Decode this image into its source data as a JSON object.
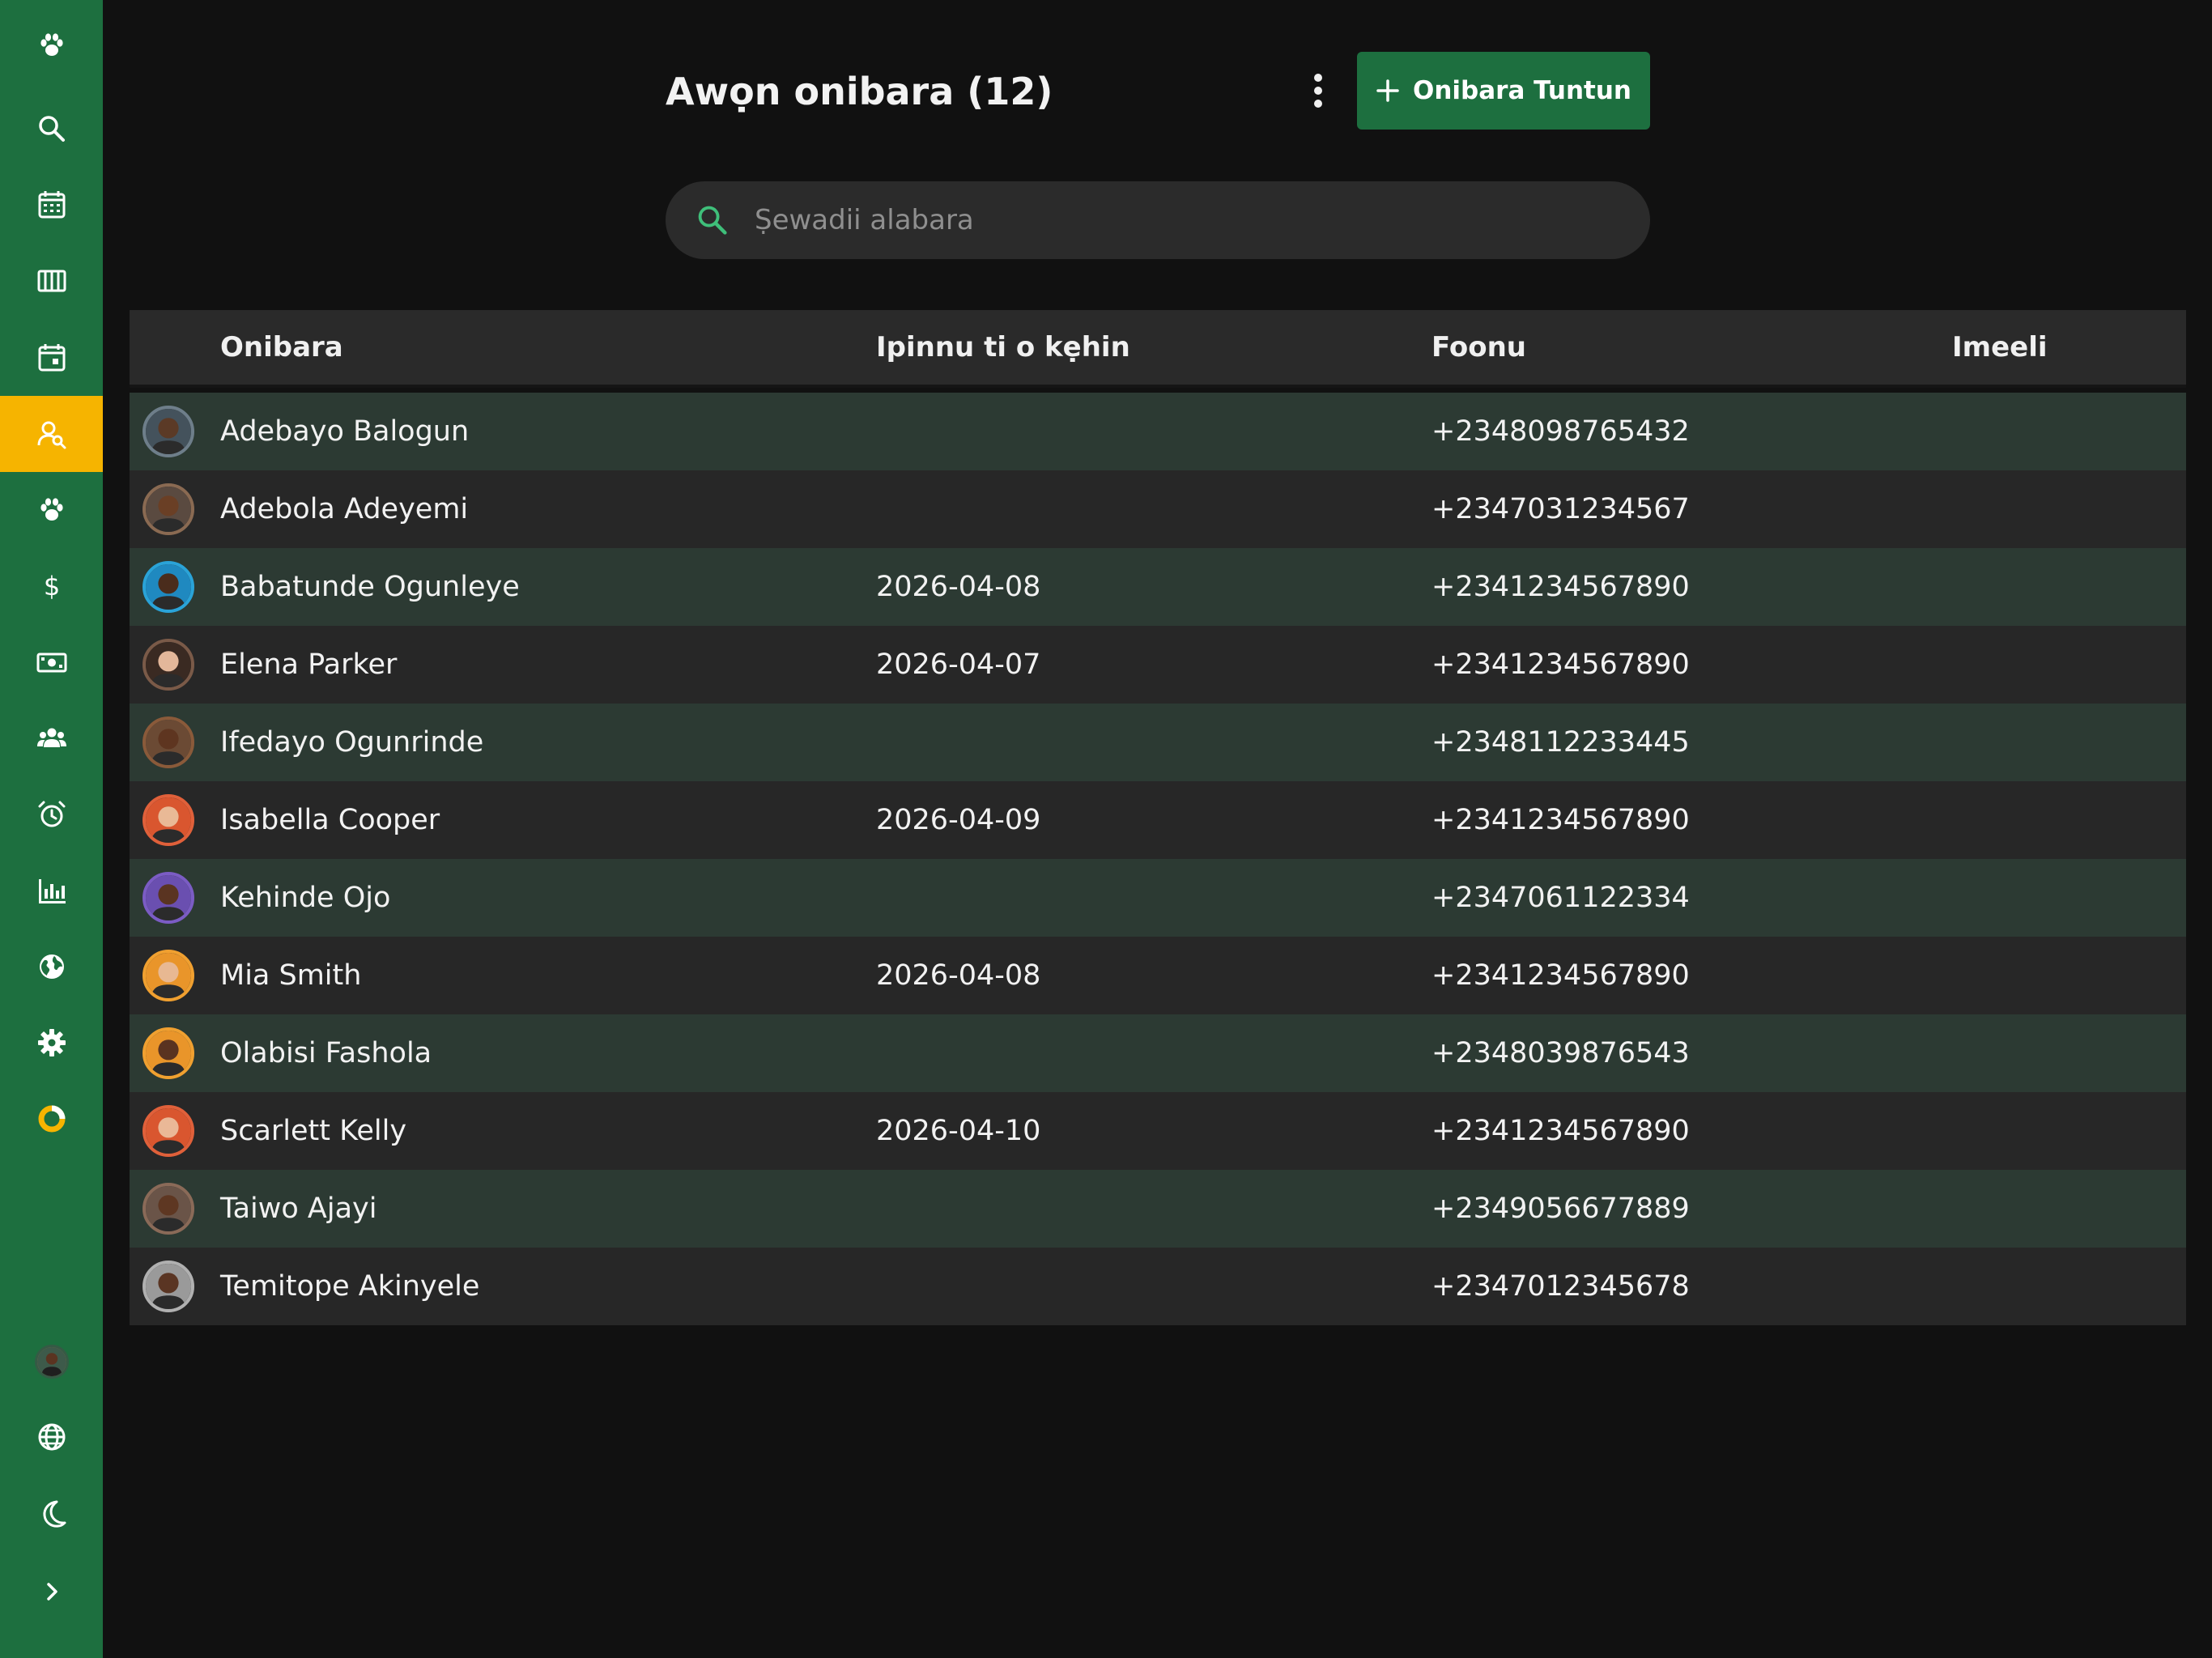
{
  "header": {
    "title": "Awọn onibara (12)",
    "add_button_label": "Onibara Tuntun"
  },
  "search": {
    "placeholder": "Ṣewadii alabara",
    "value": ""
  },
  "table": {
    "columns": [
      "Onibara",
      "Ipinnu ti o kẹhin",
      "Foonu",
      "Imeeli"
    ],
    "rows": [
      {
        "name": "Adebayo Balogun",
        "last_appointment": "",
        "phone": "+2348098765432",
        "email": "",
        "ring": "#6e7e8a",
        "skin": "#5b3a26",
        "bg": "#44525c"
      },
      {
        "name": "Adebola Adeyemi",
        "last_appointment": "",
        "phone": "+2347031234567",
        "email": "",
        "ring": "#8a6a52",
        "skin": "#6a3f25",
        "bg": "#5a4a40"
      },
      {
        "name": "Babatunde Ogunleye",
        "last_appointment": "2026-04-08",
        "phone": "+2341234567890",
        "email": "",
        "ring": "#2aa3d8",
        "skin": "#4a2c1c",
        "bg": "#1f89c0"
      },
      {
        "name": "Elena Parker",
        "last_appointment": "2026-04-07",
        "phone": "+2341234567890",
        "email": "",
        "ring": "#7a5a48",
        "skin": "#e3b79a",
        "bg": "#3a2a22"
      },
      {
        "name": "Ifedayo Ogunrinde",
        "last_appointment": "",
        "phone": "+2348112233445",
        "email": "",
        "ring": "#8a5a3a",
        "skin": "#5e3520",
        "bg": "#6b4a34"
      },
      {
        "name": "Isabella Cooper",
        "last_appointment": "2026-04-09",
        "phone": "+2341234567890",
        "email": "",
        "ring": "#e0603a",
        "skin": "#e9b996",
        "bg": "#d9562f"
      },
      {
        "name": "Kehinde Ojo",
        "last_appointment": "",
        "phone": "+2347061122334",
        "email": "",
        "ring": "#7b5cc4",
        "skin": "#5a3421",
        "bg": "#6a4fb0"
      },
      {
        "name": "Mia Smith",
        "last_appointment": "2026-04-08",
        "phone": "+2341234567890",
        "email": "",
        "ring": "#f0a030",
        "skin": "#e8b892",
        "bg": "#e9952a"
      },
      {
        "name": "Olabisi Fashola",
        "last_appointment": "",
        "phone": "+2348039876543",
        "email": "",
        "ring": "#f0a030",
        "skin": "#5a3320",
        "bg": "#e9952a"
      },
      {
        "name": "Scarlett Kelly",
        "last_appointment": "2026-04-10",
        "phone": "+2341234567890",
        "email": "",
        "ring": "#e0603a",
        "skin": "#eab897",
        "bg": "#d9562f"
      },
      {
        "name": "Taiwo Ajayi",
        "last_appointment": "",
        "phone": "+2349056677889",
        "email": "",
        "ring": "#8a6a58",
        "skin": "#5e3722",
        "bg": "#6a5448"
      },
      {
        "name": "Temitope Akinyele",
        "last_appointment": "",
        "phone": "+2347012345678",
        "email": "",
        "ring": "#b0b0b0",
        "skin": "#5a3523",
        "bg": "#9a9a9a"
      }
    ]
  },
  "sidebar": {
    "items": [
      {
        "icon": "paw-logo-icon"
      },
      {
        "icon": "search-icon"
      },
      {
        "icon": "calendar-icon"
      },
      {
        "icon": "columns-icon"
      },
      {
        "icon": "calendar-day-icon"
      },
      {
        "icon": "customer-search-icon",
        "active": true
      },
      {
        "icon": "paw-icon"
      },
      {
        "icon": "dollar-icon"
      },
      {
        "icon": "cash-icon"
      },
      {
        "icon": "team-icon"
      },
      {
        "icon": "alarm-clock-icon"
      },
      {
        "icon": "bar-chart-icon"
      },
      {
        "icon": "globe-icon"
      },
      {
        "icon": "gear-icon"
      },
      {
        "icon": "donut-icon"
      }
    ],
    "bottom": [
      {
        "icon": "user-avatar-icon"
      },
      {
        "icon": "language-globe-icon"
      },
      {
        "icon": "moon-icon"
      },
      {
        "icon": "chevron-right-icon"
      }
    ]
  },
  "colors": {
    "sidebar_bg": "#1d6f3f",
    "active_nav": "#f6b400",
    "accent_green": "#1d6f3f",
    "search_icon": "#3fbf7a",
    "row_odd": "#2c3a33",
    "row_even": "#272727",
    "background": "#111111"
  }
}
